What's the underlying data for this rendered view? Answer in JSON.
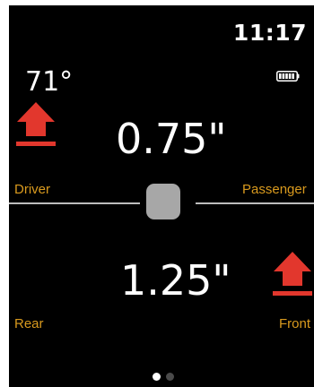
{
  "status": {
    "time": "11:17"
  },
  "temperature": "71°",
  "measurements": {
    "side_to_side": "0.75\"",
    "front_to_back": "1.25\""
  },
  "labels": {
    "driver": "Driver",
    "passenger": "Passenger",
    "rear": "Rear",
    "front": "Front"
  },
  "pages": {
    "count": 2,
    "current": 1
  },
  "colors": {
    "arrow": "#e2372d",
    "label": "#d99a1e",
    "bubble": "#a7a7a7"
  },
  "icons": {
    "battery": "battery-icon",
    "driver_arrow": "up-arrow-icon",
    "front_arrow": "up-arrow-icon"
  }
}
